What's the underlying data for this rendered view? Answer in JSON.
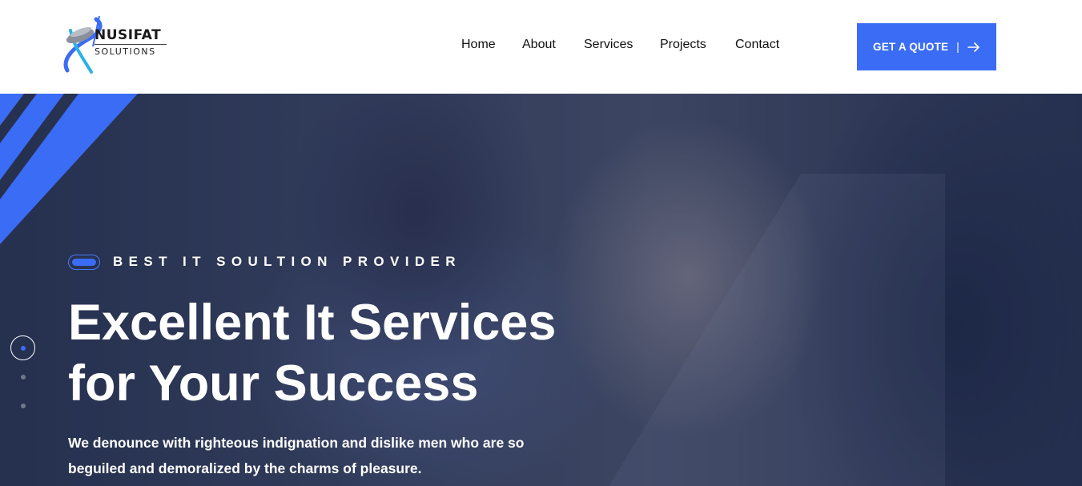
{
  "brand": {
    "name": "NUSIFAT",
    "subtitle": "SOLUTIONS",
    "colors": {
      "primary": "#3b6cf5",
      "logo_gray": "#7a7f8a",
      "logo_teal": "#2bb3e8"
    }
  },
  "nav": {
    "items": [
      {
        "label": "Home"
      },
      {
        "label": "About"
      },
      {
        "label": "Services"
      },
      {
        "label": "Projects"
      },
      {
        "label": "Contact"
      }
    ]
  },
  "cta": {
    "label": "GET A QUOTE",
    "separator": "|",
    "icon": "arrow-right-icon"
  },
  "hero": {
    "tagline": "BEST IT SOULTION PROVIDER",
    "title_line1": "Excellent It Services",
    "title_line2": "for Your Success",
    "description": "We denounce with righteous indignation and dislike men who are so beguiled and demoralized by the charms of pleasure.",
    "slider": {
      "active_index": 1,
      "total": 3
    }
  }
}
